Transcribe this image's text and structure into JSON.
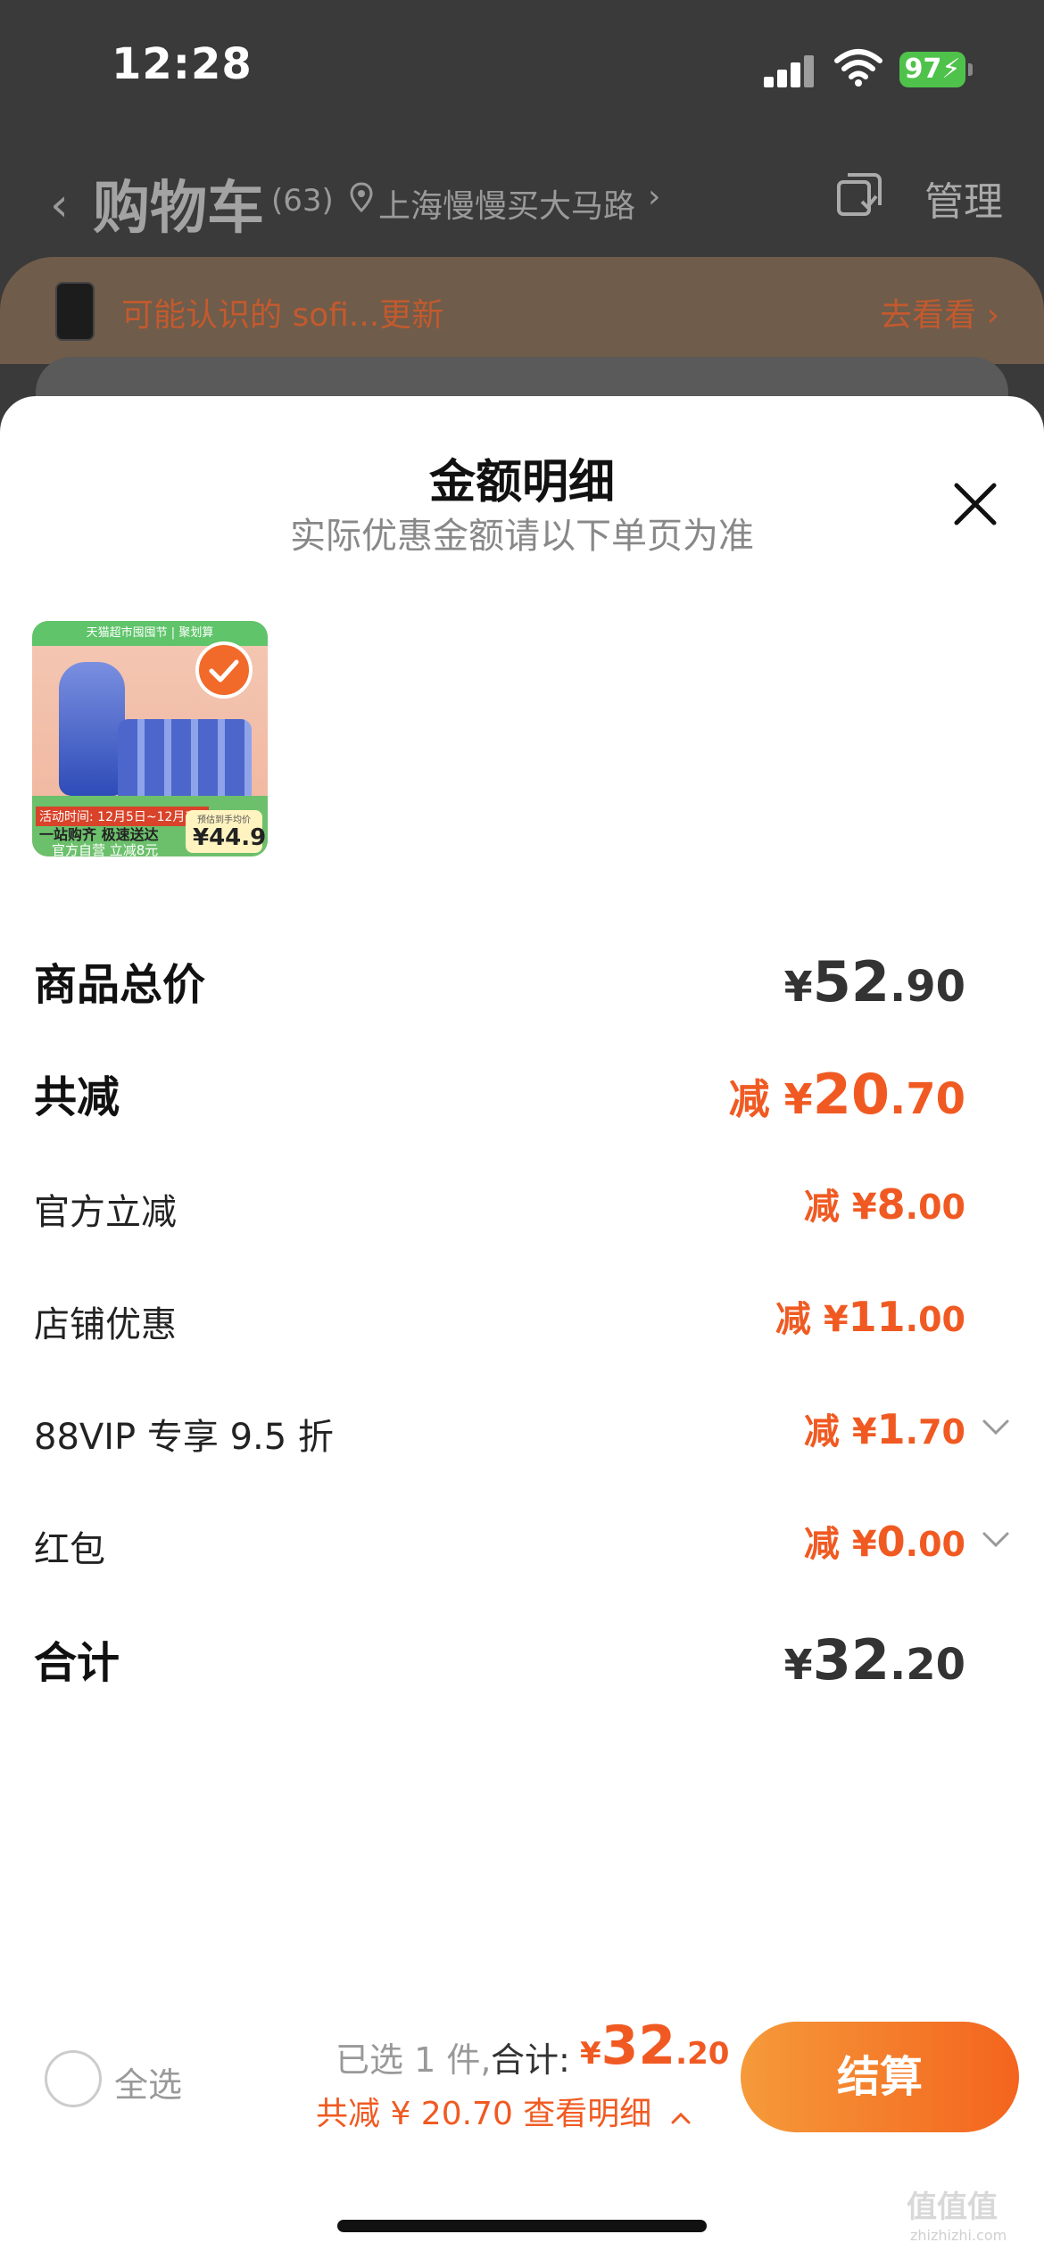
{
  "status_bar": {
    "time": "12:28",
    "battery": "97"
  },
  "nav": {
    "title": "购物车",
    "count": "(63)",
    "location": "上海慢慢买大马路",
    "manage": "管理"
  },
  "promo": {
    "text": "可能认识的 sofi...更新",
    "link": "去看看 ›"
  },
  "sheet": {
    "title": "金额明细",
    "subtitle": "实际优惠金额请以下单页为准",
    "product_thumb": {
      "band": "天猫超市囤囤节 | 聚划算",
      "tag": "活动时间: 12月5日~12月7日",
      "slogan": "一站购齐 极速送达",
      "promo": "官方自营 立减8元",
      "price_label": "预估到手均价",
      "price": "¥44.9"
    },
    "rows": {
      "total": {
        "label": "商品总价",
        "yen": "¥",
        "int": "52",
        "dec": ".90"
      },
      "discount": {
        "label": "共减",
        "prefix": "减 ",
        "yen": "¥",
        "int": "20",
        "dec": ".70"
      },
      "official": {
        "label": "官方立减",
        "prefix": "减 ",
        "yen": "¥",
        "int": "8",
        "dec": ".00"
      },
      "store": {
        "label": "店铺优惠",
        "prefix": "减 ",
        "yen": "¥",
        "int": "11",
        "dec": ".00"
      },
      "vip": {
        "label": "88VIP 专享 9.5 折",
        "prefix": "减 ",
        "yen": "¥",
        "int": "1",
        "dec": ".70"
      },
      "redpacket": {
        "label": "红包",
        "prefix": "减 ",
        "yen": "¥",
        "int": "0",
        "dec": ".00"
      },
      "sum": {
        "label": "合计",
        "yen": "¥",
        "int": "32",
        "dec": ".20"
      }
    }
  },
  "bottom": {
    "select_all": "全选",
    "selected": "已选 1 件,",
    "sum_label": "合计:",
    "sum_yen": "¥",
    "sum_int": "32",
    "sum_dec": ".20",
    "discount_line": "共减 ¥ 20.70  查看明细",
    "checkout": "结算"
  },
  "watermark": {
    "logo": "值值值",
    "url": "zhizhizhi.com"
  },
  "colors": {
    "accent": "#f05a22",
    "checkout_start": "#f59a3a",
    "checkout_end": "#f4641e"
  }
}
